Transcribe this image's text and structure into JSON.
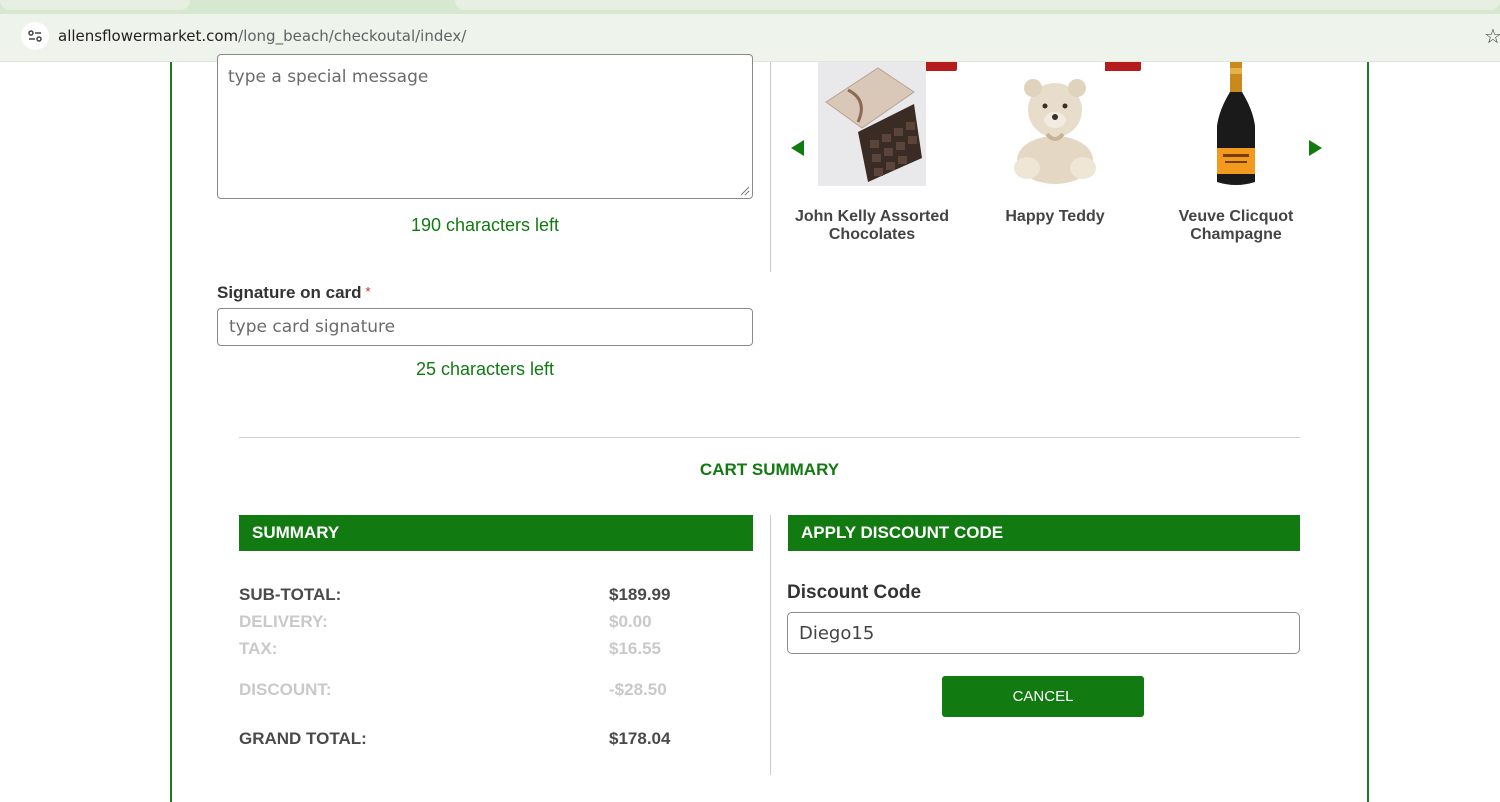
{
  "browser": {
    "url_host": "allensflowermarket.com",
    "url_path": "/long_beach/checkoutal/index/"
  },
  "message": {
    "placeholder": "type a special message",
    "chars_left": "190 characters left"
  },
  "signature": {
    "label": "Signature on card",
    "required_mark": "*",
    "placeholder": "type card signature",
    "chars_left": "25 characters left"
  },
  "addons": [
    {
      "name_line1": "John Kelly Assorted",
      "name_line2": "Chocolates",
      "icon": "chocolate-box-image"
    },
    {
      "name_line1": "Happy Teddy",
      "name_line2": "",
      "icon": "teddy-bear-image"
    },
    {
      "name_line1": "Veuve Clicquot",
      "name_line2": "Champagne",
      "icon": "champagne-bottle-image"
    }
  ],
  "cart": {
    "title": "CART SUMMARY",
    "summary_header": "SUMMARY",
    "discount_header": "APPLY DISCOUNT CODE",
    "rows": [
      {
        "label": "SUB-TOTAL:",
        "value": "$189.99"
      },
      {
        "label": "DELIVERY:",
        "value": "$0.00"
      },
      {
        "label": "TAX:",
        "value": "$16.55"
      },
      {
        "label": "DISCOUNT:",
        "value": "-$28.50"
      },
      {
        "label": "GRAND TOTAL:",
        "value": "$178.04"
      }
    ],
    "discount_label": "Discount Code",
    "discount_value": "Diego15",
    "cancel_label": "CANCEL"
  },
  "colors": {
    "brand_green": "#117a11",
    "badge_red": "#b71c1c"
  }
}
